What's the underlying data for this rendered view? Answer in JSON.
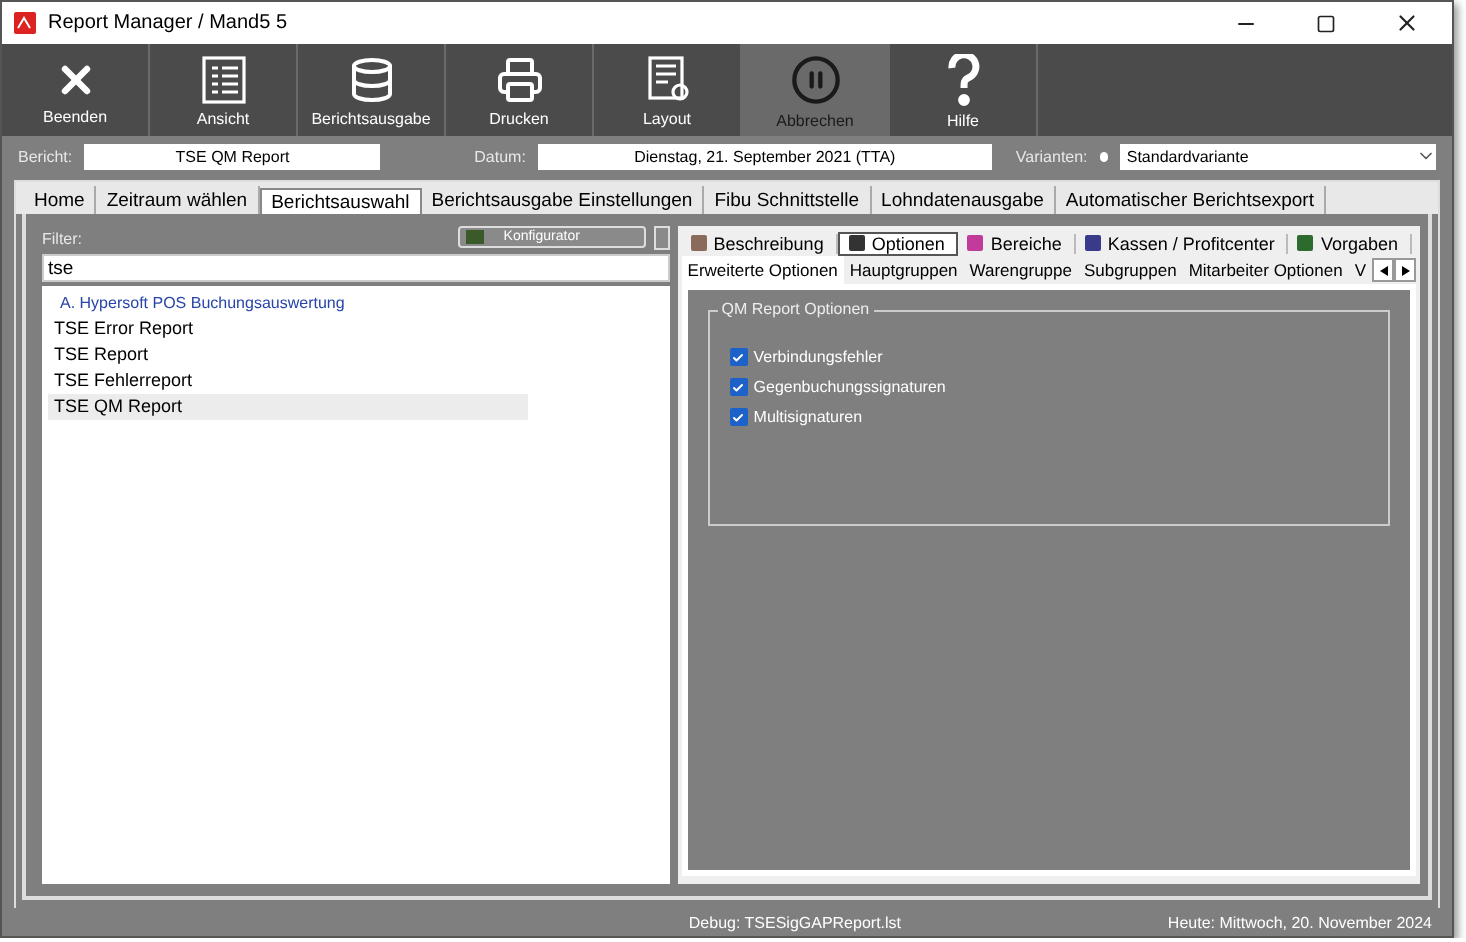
{
  "window": {
    "title": "Report Manager / Mand5 5"
  },
  "toolbar": [
    {
      "label": "Beenden",
      "kind": "close",
      "disabled": false
    },
    {
      "label": "Ansicht",
      "kind": "list",
      "disabled": false
    },
    {
      "label": "Berichtsausgabe",
      "kind": "database",
      "disabled": false
    },
    {
      "label": "Drucken",
      "kind": "printer",
      "disabled": false
    },
    {
      "label": "Layout",
      "kind": "layout",
      "disabled": false
    },
    {
      "label": "Abbrechen",
      "kind": "pause",
      "disabled": true
    },
    {
      "label": "Hilfe",
      "kind": "help",
      "disabled": false
    }
  ],
  "fields": {
    "bericht": {
      "label": "Bericht:",
      "value": "TSE QM Report"
    },
    "datum": {
      "label": "Datum:",
      "value": "Dienstag, 21. September 2021 (TTA)"
    },
    "varianten": {
      "label": "Varianten:",
      "value": "Standardvariante"
    }
  },
  "tabs": [
    {
      "label": "Home",
      "selected": false
    },
    {
      "label": "Zeitraum wählen",
      "selected": false
    },
    {
      "label": "Berichtsauswahl",
      "selected": true
    },
    {
      "label": "Berichtsausgabe Einstellungen",
      "selected": false
    },
    {
      "label": "Fibu Schnittstelle",
      "selected": false
    },
    {
      "label": "Lohndatenausgabe",
      "selected": false
    },
    {
      "label": "Automatischer Berichtsexport",
      "selected": false
    }
  ],
  "filter": {
    "label": "Filter:",
    "value": "tse",
    "configurator": "Konfigurator"
  },
  "report_list": {
    "group": "A. Hypersoft POS Buchungsauswertung",
    "items": [
      {
        "label": "TSE Error Report",
        "selected": false
      },
      {
        "label": "TSE Report",
        "selected": false
      },
      {
        "label": "TSE Fehlerreport",
        "selected": false
      },
      {
        "label": "TSE QM Report",
        "selected": true
      }
    ]
  },
  "detail_tabs": [
    {
      "label": "Beschreibung",
      "selected": false
    },
    {
      "label": "Optionen",
      "selected": true
    },
    {
      "label": "Bereiche",
      "selected": false
    },
    {
      "label": "Kassen / Profitcenter",
      "selected": false
    },
    {
      "label": "Vorgaben",
      "selected": false
    }
  ],
  "option_tabs": [
    {
      "label": "Erweiterte Optionen",
      "selected": true
    },
    {
      "label": "Hauptgruppen",
      "selected": false
    },
    {
      "label": "Warengruppe",
      "selected": false
    },
    {
      "label": "Subgruppen",
      "selected": false
    },
    {
      "label": "Mitarbeiter Optionen",
      "selected": false
    },
    {
      "label": "V",
      "selected": false
    }
  ],
  "options_group": {
    "title": "QM Report Optionen",
    "options": [
      {
        "label": "Verbindungsfehler",
        "checked": true
      },
      {
        "label": "Gegenbuchungssignaturen",
        "checked": true
      },
      {
        "label": "Multisignaturen",
        "checked": true
      }
    ]
  },
  "status_bar": {
    "debug": "Debug: TSESigGAPReport.lst",
    "today": "Heute: Mittwoch, 20. November 2024"
  }
}
